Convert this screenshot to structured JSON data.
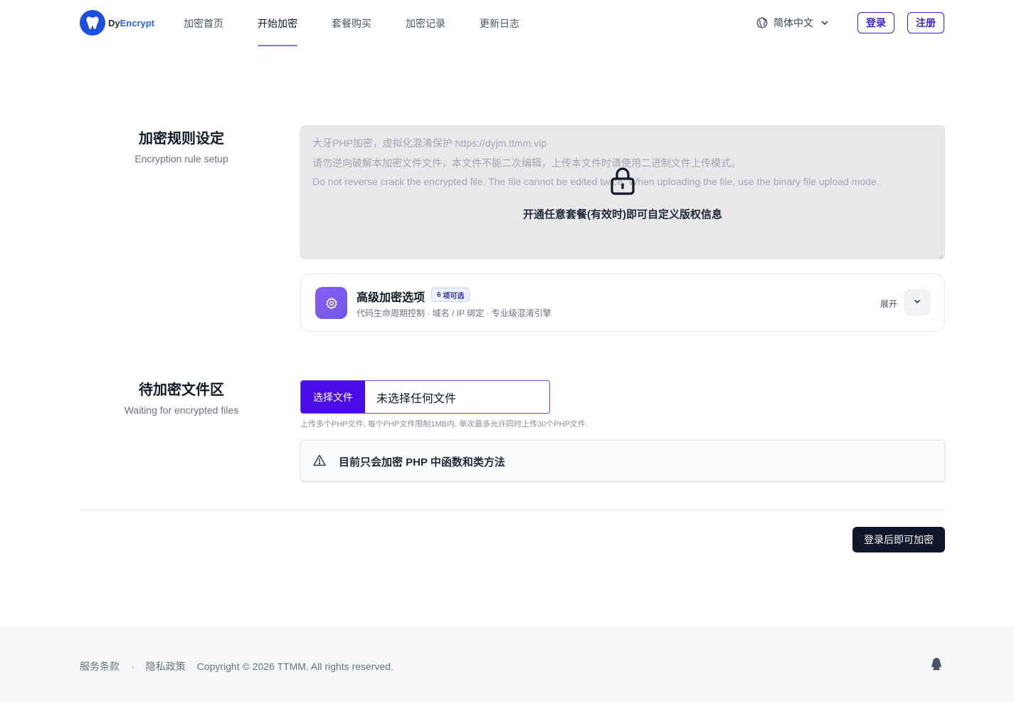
{
  "brand": {
    "name_part1": "Dy",
    "name_part2": "Encrypt"
  },
  "nav": {
    "items": [
      {
        "label": "加密首页"
      },
      {
        "label": "开始加密"
      },
      {
        "label": "套餐购买"
      },
      {
        "label": "加密记录"
      },
      {
        "label": "更新日志"
      }
    ],
    "active": "开始加密"
  },
  "header": {
    "language": "简体中文",
    "login_label": "登录",
    "register_label": "注册"
  },
  "rules": {
    "title": "加密规则设定",
    "subtitle": "Encryption rule setup",
    "copyright_lines": [
      "大牙PHP加密，虚拟化混淆保护 https://dyjm.ttmm.vip",
      "请勿逆向破解本加密文件文件，本文件不能二次编辑，上传本文件时请使用二进制文件上传模式。",
      "Do not reverse crack the encrypted file. The file cannot be edited twice. When uploading the file, use the binary file upload mode."
    ],
    "lock_message": "开通任意套餐(有效时)即可自定义版权信息"
  },
  "advanced": {
    "title": "高级加密选项",
    "badge_count": "6",
    "badge_text": "项可选",
    "description": "代码生命周期控制 · 域名 / IP 绑定 · 专业级混淆引擎",
    "expand_label": "展开"
  },
  "files": {
    "title": "待加密文件区",
    "subtitle": "Waiting for encrypted files",
    "choose_label": "选择文件",
    "no_file": "未选择任何文件",
    "hint": "上传多个PHP文件, 每个PHP文件限制1MB内, 单次最多允许同时上传30个PHP文件.",
    "warning": "目前只会加密 PHP 中函数和类方法"
  },
  "submit_label": "登录后即可加密",
  "footer": {
    "terms": "服务条款",
    "separator": "·",
    "privacy": "隐私政策",
    "copyright": "Copyright © 2026 TTMM. All rights reserved."
  },
  "colors": {
    "accent": "#4a0be8",
    "brand_blue": "#1a4fe0",
    "dark_button": "#0f172a"
  },
  "icons": [
    "logo-icon",
    "globe-icon",
    "chevron-down-icon",
    "lock-icon",
    "gear-icon",
    "warning-icon",
    "qq-icon"
  ]
}
